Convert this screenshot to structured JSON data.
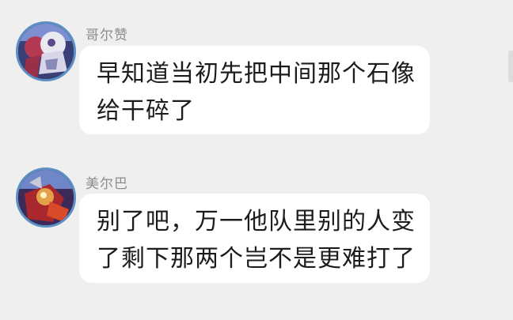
{
  "messages": [
    {
      "sender": "哥尔赞",
      "avatar_icon": "hero-avatar-purple",
      "lines": [
        "早知道当初先把中间那个石像",
        "给干碎了"
      ]
    },
    {
      "sender": "美尔巴",
      "avatar_icon": "hero-avatar-red",
      "lines": [
        "别了吧，万一他队里别的人变",
        "了剩下那两个岂不是更难打了"
      ]
    }
  ],
  "colors": {
    "background": "#efefef",
    "bubble": "#ffffff",
    "sender_text": "#8c8c8c",
    "message_text": "#1c1c1c",
    "avatar_ring": "#5c8fc4"
  }
}
